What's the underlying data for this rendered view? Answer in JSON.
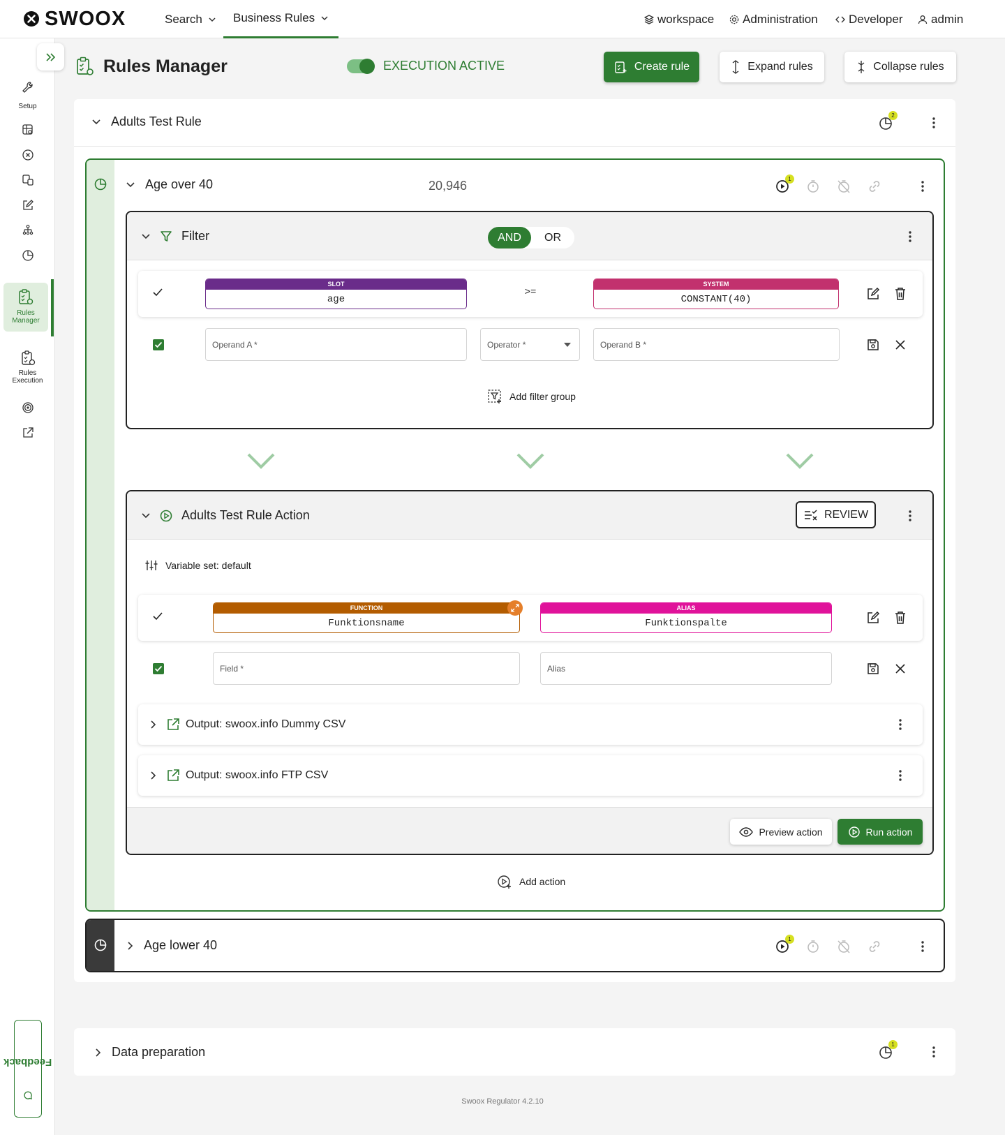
{
  "brand": {
    "name": "SWOOX",
    "accent": "#2e7d32"
  },
  "topnav": {
    "search": "Search",
    "business_rules": "Business Rules",
    "workspace": "workspace",
    "administration": "Administration",
    "developer": "Developer",
    "user": "admin"
  },
  "sidebar": {
    "setup": "Setup",
    "rules_manager": "Rules Manager",
    "rules_execution": "Rules Execution",
    "feedback": "Feedback"
  },
  "header": {
    "title": "Rules Manager",
    "execution_status": "EXECUTION ACTIVE",
    "create_rule": "Create rule",
    "expand_rules": "Expand rules",
    "collapse_rules": "Collapse rules"
  },
  "rule_groups": [
    {
      "title": "Adults Test Rule",
      "badge": "2"
    },
    {
      "title": "Data preparation",
      "badge": "1"
    }
  ],
  "rule_age_over": {
    "title": "Age over 40",
    "count": "20,946",
    "play_badge": "1",
    "filter": {
      "title": "Filter",
      "and_label": "AND",
      "or_label": "OR",
      "condition": {
        "operand_a_type": "SLOT",
        "operand_a": "age",
        "operator": ">=",
        "operand_b_type": "SYSTEM",
        "operand_b": "CONSTANT(40)"
      },
      "new_condition": {
        "operand_a_placeholder": "Operand A *",
        "operator_placeholder": "Operator *",
        "operand_b_placeholder": "Operand B *"
      },
      "add_filter_group": "Add filter group"
    },
    "action": {
      "title": "Adults Test Rule Action",
      "review": "REVIEW",
      "variable_set": "Variable set: default",
      "mapping": {
        "field_type": "FUNCTION",
        "field": "Funktionsname",
        "alias_type": "ALIAS",
        "alias": "Funktionspalte"
      },
      "new_mapping": {
        "field_placeholder": "Field *",
        "alias_placeholder": "Alias"
      },
      "outputs": [
        "Output: swoox.info Dummy CSV",
        "Output: swoox.info FTP CSV"
      ],
      "preview_action": "Preview action",
      "run_action": "Run action"
    },
    "add_action": "Add action"
  },
  "rule_age_lower": {
    "title": "Age lower 40",
    "play_badge": "1"
  },
  "footer": "Swoox Regulator 4.2.10",
  "colors": {
    "slot": "#6a2c8a",
    "system": "#c2316e",
    "function": "#b35c00",
    "alias": "#e0129a"
  }
}
